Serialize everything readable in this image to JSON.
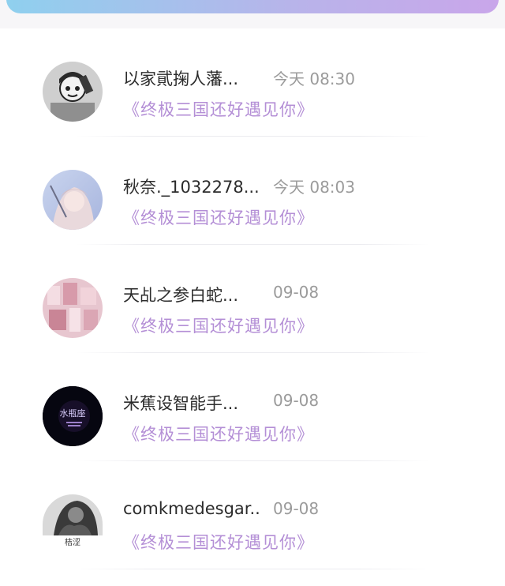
{
  "messages": [
    {
      "name": "以家貮掬人藩...",
      "time": "今天 08:30",
      "subtitle": "《终极三国还好遇见你》",
      "avatar_text": ""
    },
    {
      "name": "秋奈._1032278...",
      "time": "今天 08:03",
      "subtitle": "《终极三国还好遇见你》",
      "avatar_text": ""
    },
    {
      "name": "天乩之参白蛇...",
      "time": "09-08",
      "subtitle": "《终极三国还好遇见你》",
      "avatar_text": ""
    },
    {
      "name": "米蕉设智能手...",
      "time": "09-08",
      "subtitle": "《终极三国还好遇见你》",
      "avatar_text": "水瓶座"
    },
    {
      "name": "comkmedesgar...",
      "time": "09-08",
      "subtitle": "《终极三国还好遇见你》",
      "avatar_text": "桔涩"
    }
  ],
  "colors": {
    "subtitle": "#b48fd6",
    "time": "#9b9b9b",
    "name": "#2c2c2c"
  }
}
